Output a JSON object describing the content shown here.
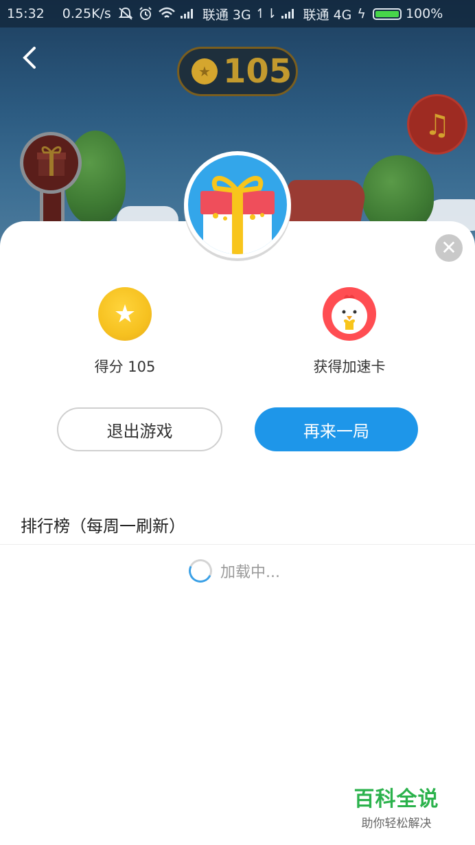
{
  "status_bar": {
    "time": "15:32",
    "speed": "0.25K/s",
    "carrier1": "联通 3G",
    "carrier2": "联通 4G",
    "battery": "100%"
  },
  "header": {
    "score": "105",
    "coin_icon": "star-coin-icon",
    "back_icon": "chevron-left-icon",
    "music_icon": "music-note-icon"
  },
  "result": {
    "rewards": [
      {
        "icon": "star-coin-icon",
        "label": "得分 105"
      },
      {
        "icon": "chick-card-icon",
        "label": "获得加速卡"
      }
    ],
    "exit_label": "退出游戏",
    "again_label": "再来一局"
  },
  "leaderboard": {
    "title": "排行榜（每周一刷新）",
    "loading_text": "加载中..."
  },
  "watermark": {
    "brand": "百科全说",
    "slogan": "助你轻松解决"
  },
  "colors": {
    "primary_button": "#1e96e9",
    "coin": "#f6c120",
    "chick_bg": "#ff4d52"
  }
}
